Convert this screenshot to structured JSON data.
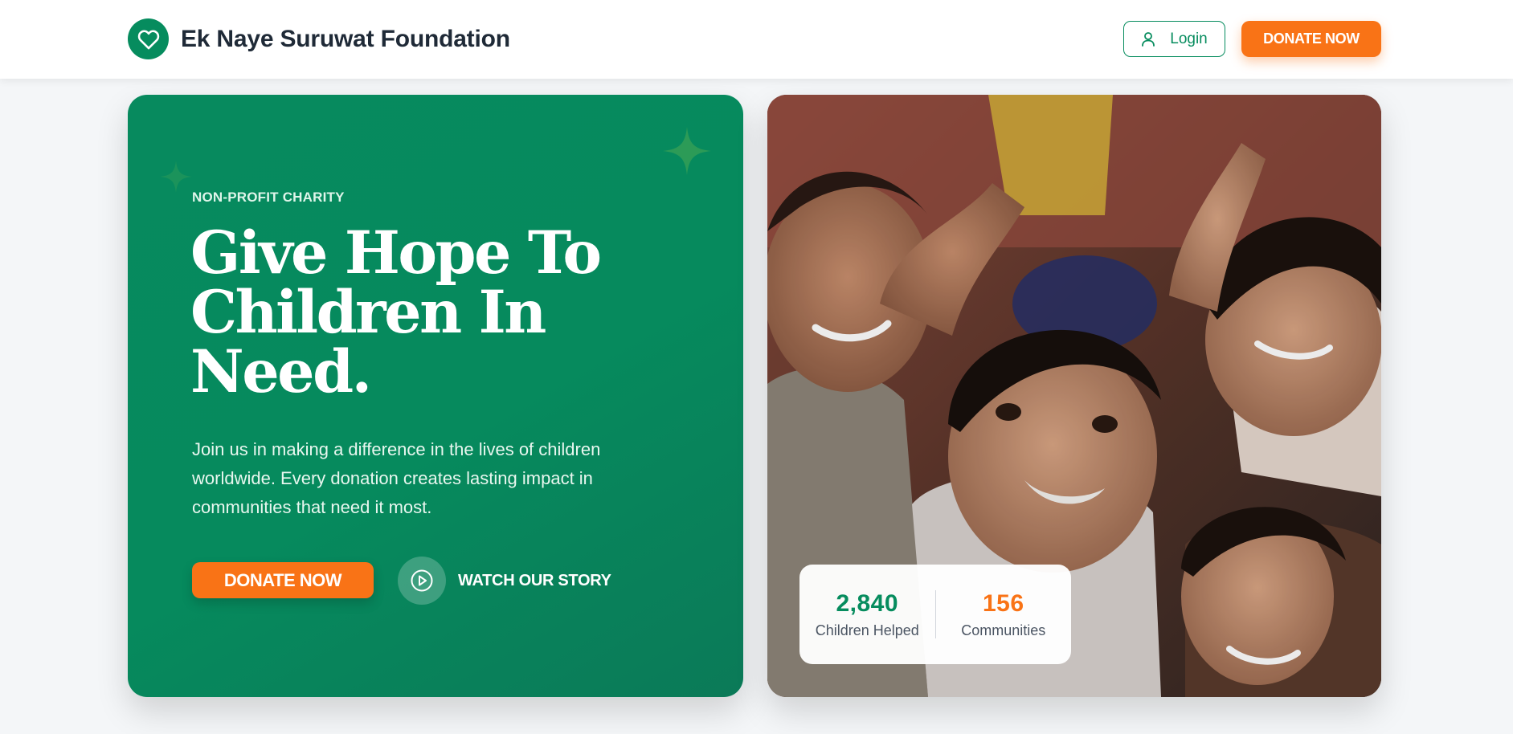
{
  "header": {
    "brand_name": "Ek Naye Suruwat Foundation",
    "logo_icon": "heart-icon",
    "login_label": "Login",
    "donate_label": "DONATE NOW"
  },
  "hero": {
    "eyebrow": "NON-PROFIT CHARITY",
    "headline": "Give Hope To Children In Need.",
    "lead": "Join us in making a difference in the lives of children worldwide. Every donation creates lasting impact in communities that need it most.",
    "donate_label": "DONATE NOW",
    "watch_label": "WATCH OUR STORY"
  },
  "stats": {
    "children_helped": {
      "value": "2,840",
      "label": "Children Helped",
      "color": "#068c5e"
    },
    "communities": {
      "value": "156",
      "label": "Communities",
      "color": "#f97316"
    }
  },
  "colors": {
    "brand_green": "#068c5e",
    "accent_orange": "#f97316"
  }
}
